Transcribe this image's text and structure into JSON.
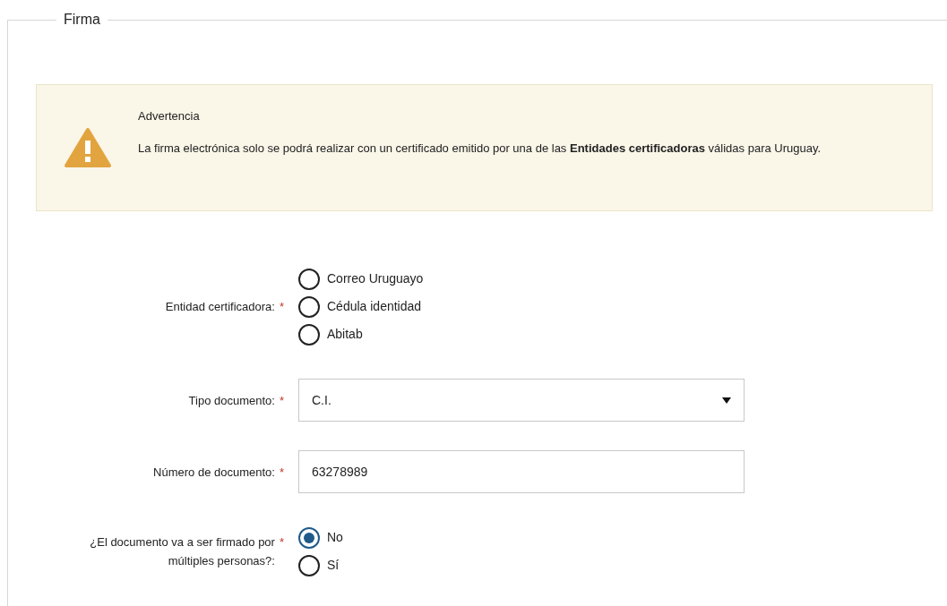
{
  "section": {
    "title": "Firma"
  },
  "alert": {
    "title": "Advertencia",
    "message": "La firma electrónica solo se podrá realizar con un certificado emitido por una de las **Entidades certificadoras** válidas para Uruguay."
  },
  "fields": [
    {
      "kind": "radio",
      "label": "Entidad certificadora:",
      "required_mark": "*",
      "options": [
        {
          "label": "Correo Uruguayo",
          "selected": false
        },
        {
          "label": "Cédula identidad",
          "selected": false
        },
        {
          "label": "Abitab",
          "selected": false
        }
      ]
    },
    {
      "kind": "select",
      "label": "Tipo documento:",
      "required_mark": "*",
      "value": "C.I."
    },
    {
      "kind": "text",
      "label": "Número de documento:",
      "required_mark": "*",
      "value": "63278989"
    },
    {
      "kind": "radio",
      "label": "¿El documento va a ser firmado por múltiples personas?:",
      "required_mark": "*",
      "options": [
        {
          "label": "No",
          "selected": true
        },
        {
          "label": "Sí",
          "selected": false
        }
      ]
    }
  ]
}
